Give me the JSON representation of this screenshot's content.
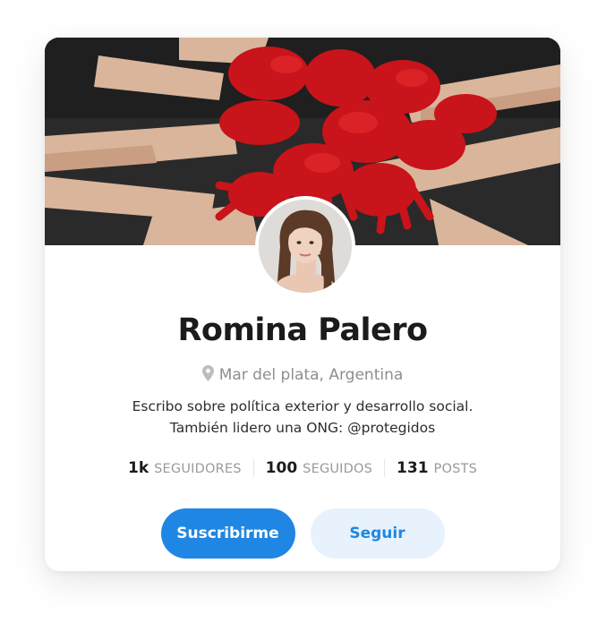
{
  "profile": {
    "name": "Romina Palero",
    "location": "Mar del plata, Argentina",
    "bio_line1": "Escribo sobre política exterior y desarrollo social.",
    "bio_line2": "También lidero una ONG: @protegidos"
  },
  "stats": [
    {
      "value": "1k",
      "label": "SEGUIDORES"
    },
    {
      "value": "100",
      "label": "SEGUIDOS"
    },
    {
      "value": "131",
      "label": "POSTS"
    }
  ],
  "actions": {
    "subscribe_label": "Suscribirme",
    "follow_label": "Seguir"
  },
  "colors": {
    "accent": "#1f87e3",
    "accent_light": "#e7f2fd"
  },
  "icons": {
    "location": "map-pin-icon"
  }
}
